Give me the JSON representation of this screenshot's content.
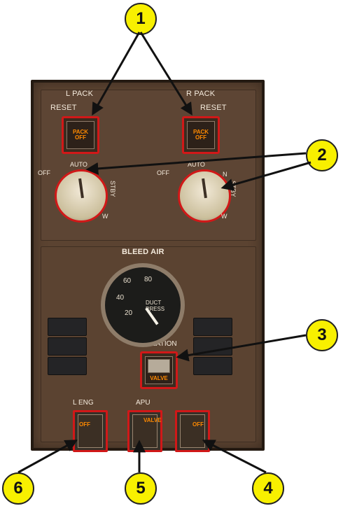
{
  "callouts": [
    "1",
    "2",
    "3",
    "4",
    "5",
    "6"
  ],
  "panel": {
    "left_pack_label": "L PACK",
    "right_pack_label": "R PACK",
    "reset_label": "RESET",
    "left_pack_button_line1": "PACK",
    "left_pack_button_line2": "OFF",
    "right_pack_button_line1": "PACK",
    "right_pack_button_line2": "OFF",
    "off_label": "OFF",
    "auto_label": "AUTO",
    "stby_label": "STBY",
    "n_label": "N",
    "w_label": "W",
    "bleed_air_title": "BLEED AIR",
    "duct_line1": "DUCT",
    "duct_line2": "PRESS",
    "isolation_label": "ISOLATION",
    "valve_text": "VALVE",
    "l_eng_label": "L ENG",
    "apu_label": "APU",
    "off_text": "OFF",
    "valve_vertical": "VALVE"
  },
  "gauge": {
    "ticks": [
      "20",
      "40",
      "60",
      "80"
    ],
    "needle_value": 0
  }
}
